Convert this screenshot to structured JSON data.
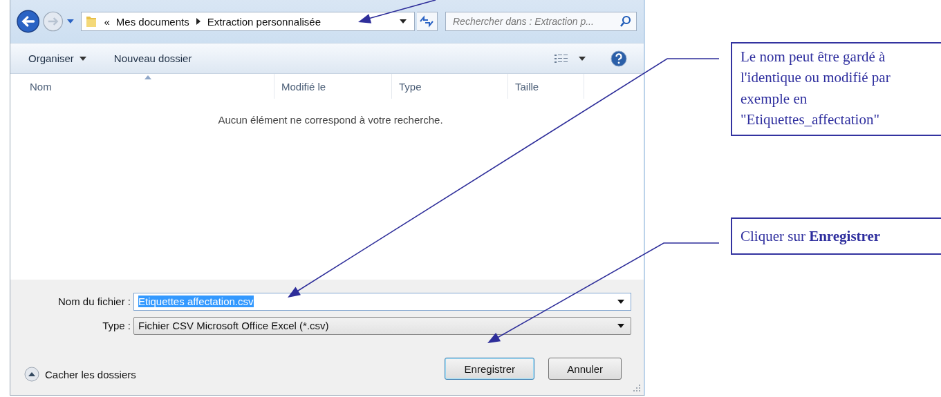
{
  "dialog": {
    "breadcrumb": {
      "prefix": "«",
      "items": [
        "Mes documents",
        "Extraction personnalisée"
      ]
    },
    "search": {
      "placeholder": "Rechercher dans : Extraction p..."
    },
    "toolbar": {
      "organize": "Organiser",
      "new_folder": "Nouveau dossier"
    },
    "columns": [
      "Nom",
      "Modifié le",
      "Type",
      "Taille"
    ],
    "empty_message": "Aucun élément ne correspond à votre recherche.",
    "fields": [
      {
        "label": "Nom du fichier :",
        "value": "Etiquettes affectation.csv",
        "kind": "text",
        "text_selected": true
      },
      {
        "label": "Type :",
        "value": "Fichier CSV Microsoft Office Excel (*.csv)",
        "kind": "select",
        "text_selected": false
      }
    ],
    "hide_folders": "Cacher les dossiers",
    "buttons": [
      {
        "label": "Enregistrer",
        "default": true
      },
      {
        "label": "Annuler",
        "default": false
      }
    ]
  },
  "annotations": [
    {
      "text": "Le nom peut être gardé à l'identique ou modifié par exemple en \"Etiquettes_affectation\""
    },
    {
      "text": "Cliquer sur **Enregistrer**"
    }
  ]
}
